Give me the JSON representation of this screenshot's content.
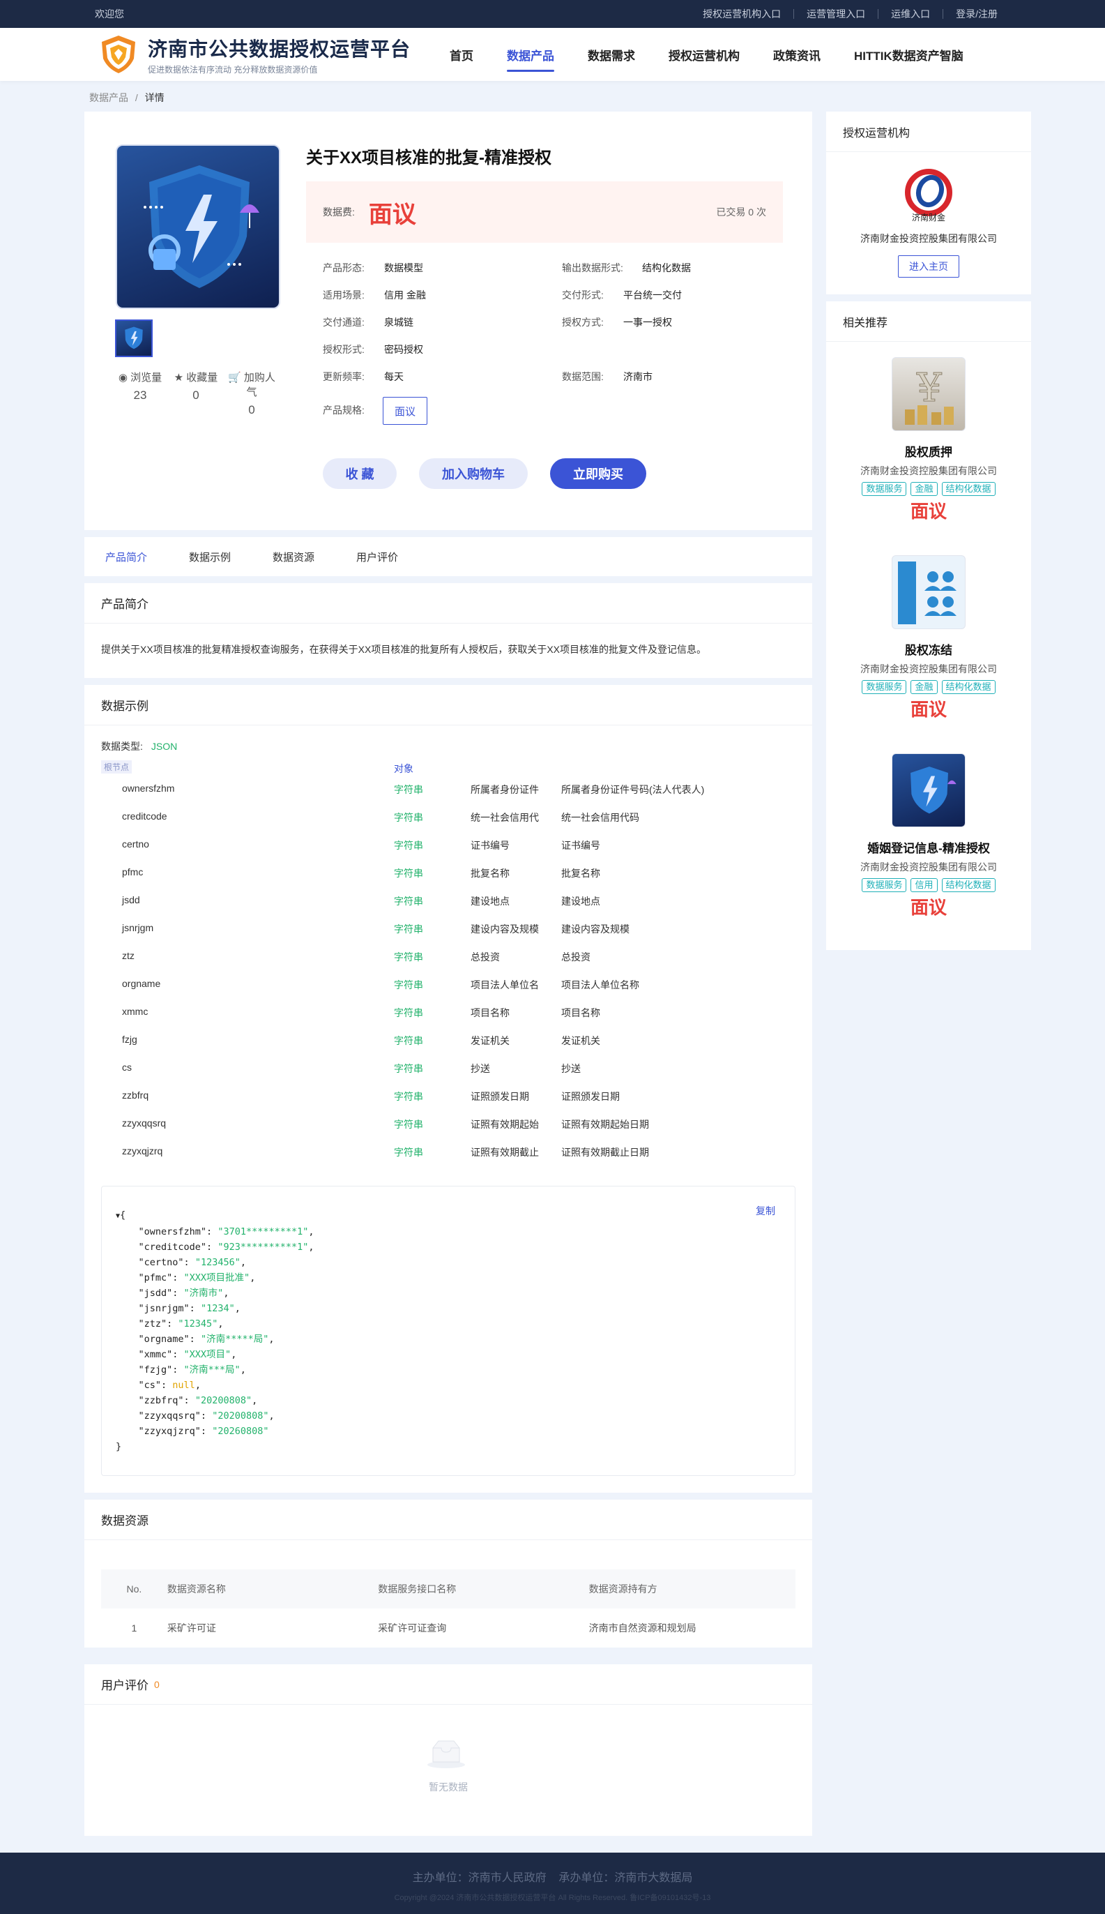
{
  "topbar": {
    "welcome": "欢迎您",
    "links": [
      "授权运营机构入口",
      "运营管理入口",
      "运维入口",
      "登录/注册"
    ]
  },
  "header": {
    "title": "济南市公共数据授权运营平台",
    "subtitle": "促进数据依法有序流动 充分释放数据资源价值",
    "nav": [
      "首页",
      "数据产品",
      "数据需求",
      "授权运营机构",
      "政策资讯",
      "HITTIK数据资产智脑"
    ],
    "active_nav": "数据产品"
  },
  "breadcrumb": {
    "parent": "数据产品",
    "sep": "/",
    "current": "详情"
  },
  "product": {
    "title": "关于XX项目核准的批复-精准授权",
    "price_label": "数据费:",
    "price": "面议",
    "traded": "已交易 0 次",
    "stats": [
      {
        "icon": "eye-icon",
        "label": "浏览量",
        "value": "23"
      },
      {
        "icon": "star-icon",
        "label": "收藏量",
        "value": "0"
      },
      {
        "icon": "cart-icon",
        "label": "加购人气",
        "value": "0"
      }
    ],
    "attrs": {
      "form": {
        "k": "产品形态:",
        "v": "数据模型"
      },
      "output": {
        "k": "输出数据形式:",
        "v": "结构化数据"
      },
      "scene": {
        "k": "适用场景:",
        "v": "信用  金融"
      },
      "delivery_form": {
        "k": "交付形式:",
        "v": "平台统一交付"
      },
      "channel": {
        "k": "交付通道:",
        "v": "泉城链"
      },
      "auth_mode": {
        "k": "授权方式:",
        "v": "一事一授权"
      },
      "auth_form": {
        "k": "授权形式:",
        "v": "密码授权"
      },
      "freq": {
        "k": "更新频率:",
        "v": "每天"
      },
      "range": {
        "k": "数据范围:",
        "v": "济南市"
      },
      "spec": {
        "k": "产品规格:",
        "v": "面议"
      }
    },
    "buttons": {
      "fav": "收 藏",
      "cart": "加入购物车",
      "buy": "立即购买"
    }
  },
  "tabs": [
    "产品简介",
    "数据示例",
    "数据资源",
    "用户评价"
  ],
  "intro": {
    "title": "产品简介",
    "text": "提供关于XX项目核准的批复精准授权查询服务，在获得关于XX项目核准的批复所有人授权后，获取关于XX项目核准的批复文件及登记信息。"
  },
  "example": {
    "title": "数据示例",
    "type_label": "数据类型:",
    "type": "JSON",
    "node_tag": "根节点",
    "obj": "对象",
    "fields": [
      [
        "ownersfzhm",
        "字符串",
        "所属者身份证件",
        "所属者身份证件号码(法人代表人)"
      ],
      [
        "creditcode",
        "字符串",
        "统一社会信用代",
        "统一社会信用代码"
      ],
      [
        "certno",
        "字符串",
        "证书编号",
        "证书编号"
      ],
      [
        "pfmc",
        "字符串",
        "批复名称",
        "批复名称"
      ],
      [
        "jsdd",
        "字符串",
        "建设地点",
        "建设地点"
      ],
      [
        "jsnrjgm",
        "字符串",
        "建设内容及规模",
        "建设内容及规模"
      ],
      [
        "ztz",
        "字符串",
        "总投资",
        "总投资"
      ],
      [
        "orgname",
        "字符串",
        "项目法人单位名",
        "项目法人单位名称"
      ],
      [
        "xmmc",
        "字符串",
        "项目名称",
        "项目名称"
      ],
      [
        "fzjg",
        "字符串",
        "发证机关",
        "发证机关"
      ],
      [
        "cs",
        "字符串",
        "抄送",
        "抄送"
      ],
      [
        "zzbfrq",
        "字符串",
        "证照颁发日期",
        "证照颁发日期"
      ],
      [
        "zzyxqqsrq",
        "字符串",
        "证照有效期起始",
        "证照有效期起始日期"
      ],
      [
        "zzyxqjzrq",
        "字符串",
        "证照有效期截止",
        "证照有效期截止日期"
      ]
    ],
    "copy": "复制",
    "json_open": "{",
    "json_close": "}",
    "json": [
      [
        "ownersfzhm",
        "\"3701*********1\"",
        "str"
      ],
      [
        "creditcode",
        "\"923**********1\"",
        "str"
      ],
      [
        "certno",
        "\"123456\"",
        "str"
      ],
      [
        "pfmc",
        "\"XXX项目批准\"",
        "str"
      ],
      [
        "jsdd",
        "\"济南市\"",
        "str"
      ],
      [
        "jsnrjgm",
        "\"1234\"",
        "str"
      ],
      [
        "ztz",
        "\"12345\"",
        "str"
      ],
      [
        "orgname",
        "\"济南*****局\"",
        "str"
      ],
      [
        "xmmc",
        "\"XXX项目\"",
        "str"
      ],
      [
        "fzjg",
        "\"济南***局\"",
        "str"
      ],
      [
        "cs",
        "null",
        "nul"
      ],
      [
        "zzbfrq",
        "\"20200808\"",
        "str"
      ],
      [
        "zzyxqqsrq",
        "\"20200808\"",
        "str"
      ],
      [
        "zzyxqjzrq",
        "\"20260808\"",
        "str"
      ]
    ]
  },
  "resource": {
    "title": "数据资源",
    "headers": [
      "No.",
      "数据资源名称",
      "数据服务接口名称",
      "数据资源持有方"
    ],
    "rows": [
      [
        "1",
        "采矿许可证",
        "采矿许可证查询",
        "济南市自然资源和规划局"
      ]
    ]
  },
  "review": {
    "title": "用户评价",
    "count": "0",
    "empty": "暂无数据"
  },
  "side": {
    "org_title": "授权运营机构",
    "org_name": "济南财金投资控股集团有限公司",
    "org_logo_text": "济南财金",
    "org_btn": "进入主页",
    "rec_title": "相关推荐",
    "recs": [
      {
        "name": "股权质押",
        "company": "济南财金投资控股集团有限公司",
        "tags": [
          "数据服务",
          "金融",
          "结构化数据"
        ],
        "price": "面议"
      },
      {
        "name": "股权冻结",
        "company": "济南财金投资控股集团有限公司",
        "tags": [
          "数据服务",
          "金融",
          "结构化数据"
        ],
        "price": "面议"
      },
      {
        "name": "婚姻登记信息-精准授权",
        "company": "济南财金投资控股集团有限公司",
        "tags": [
          "数据服务",
          "信用",
          "结构化数据"
        ],
        "price": "面议"
      }
    ]
  },
  "footer": {
    "line1": "主办单位：济南市人民政府    承办单位：济南市大数据局",
    "line2": "Copyright @2024 济南市公共数据授权运营平台 All Rights Reserved. 鲁ICP备09101432号-13"
  },
  "colors": {
    "accent": "#3b54d6",
    "price": "#e8403a",
    "green": "#22b26b",
    "dark": "#1d2a45"
  }
}
